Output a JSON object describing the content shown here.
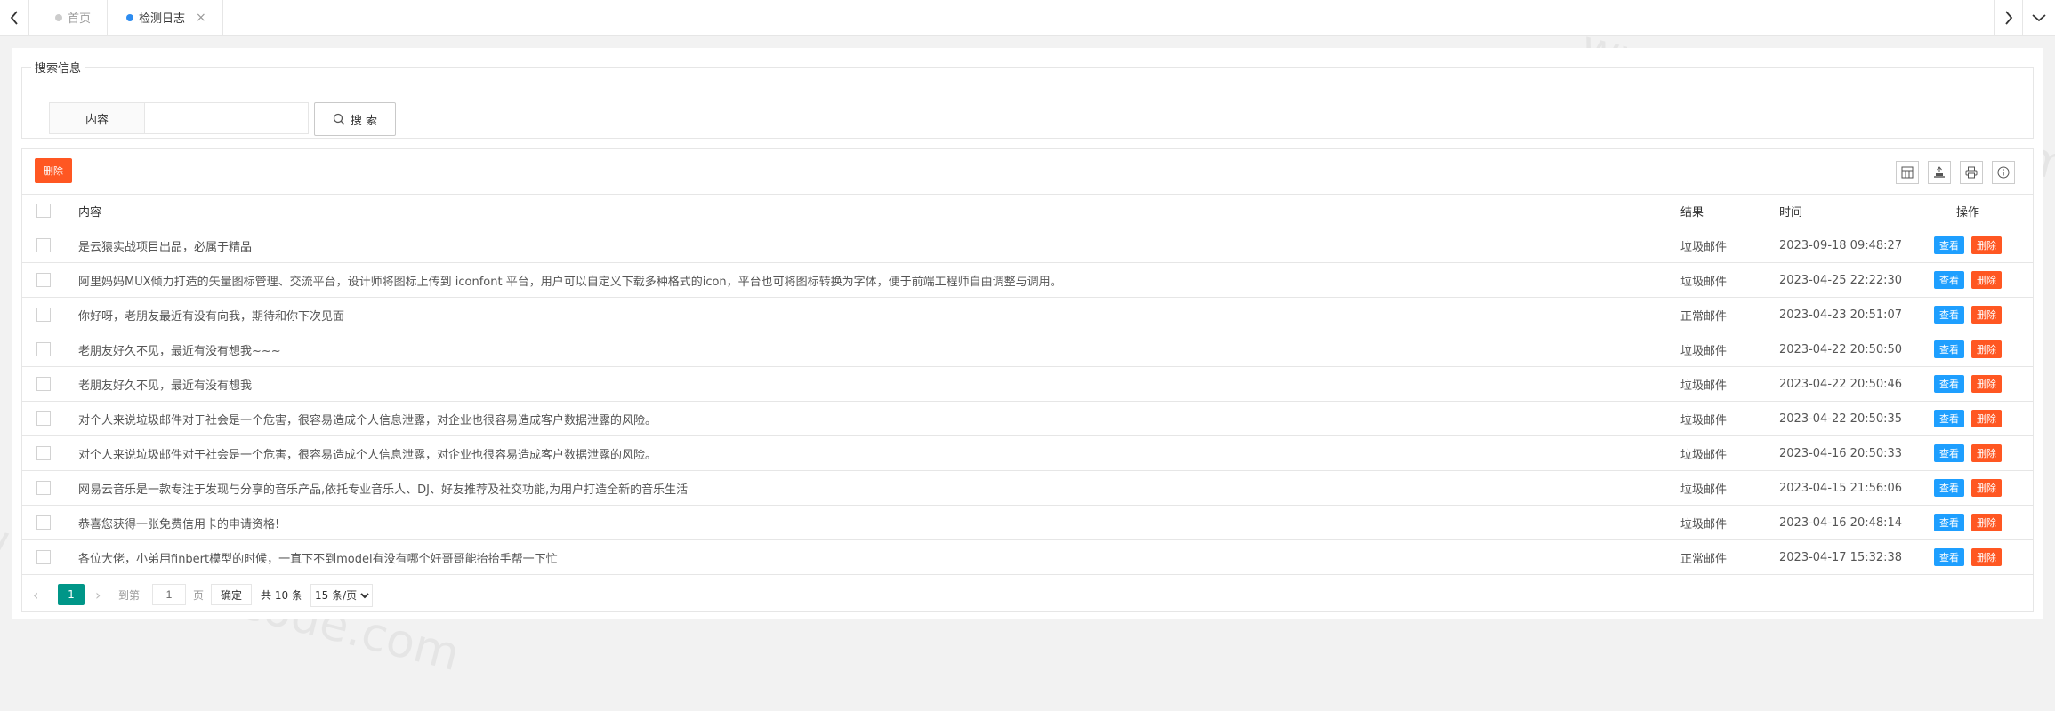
{
  "tabs": [
    {
      "label": "首页",
      "active": false
    },
    {
      "label": "检测日志",
      "active": true,
      "closable": true
    }
  ],
  "search": {
    "legend": "搜索信息",
    "label": "内容",
    "value": "",
    "button_label": "搜 索"
  },
  "toolbar": {
    "delete_label": "删除",
    "icons": [
      "columns-filter-icon",
      "export-icon",
      "print-icon",
      "info-icon"
    ]
  },
  "table": {
    "headers": {
      "content": "内容",
      "result": "结果",
      "time": "时间",
      "ops": "操作"
    },
    "view_label": "查看",
    "delete_label": "删除",
    "rows": [
      {
        "content": "是云猿实战项目出品，必属于精品",
        "result": "垃圾邮件",
        "time": "2023-09-18 09:48:27"
      },
      {
        "content": "阿里妈妈MUX倾力打造的矢量图标管理、交流平台，设计师将图标上传到 iconfont 平台，用户可以自定义下载多种格式的icon，平台也可将图标转换为字体，便于前端工程师自由调整与调用。",
        "result": "垃圾邮件",
        "time": "2023-04-25 22:22:30"
      },
      {
        "content": "你好呀，老朋友最近有没有向我，期待和你下次见面",
        "result": "正常邮件",
        "time": "2023-04-23 20:51:07"
      },
      {
        "content": "老朋友好久不见，最近有没有想我~~~",
        "result": "垃圾邮件",
        "time": "2023-04-22 20:50:50"
      },
      {
        "content": "老朋友好久不见，最近有没有想我",
        "result": "垃圾邮件",
        "time": "2023-04-22 20:50:46"
      },
      {
        "content": "对个人来说垃圾邮件对于社会是一个危害，很容易造成个人信息泄露，对企业也很容易造成客户数据泄露的风险。",
        "result": "垃圾邮件",
        "time": "2023-04-22 20:50:35"
      },
      {
        "content": "对个人来说垃圾邮件对于社会是一个危害，很容易造成个人信息泄露，对企业也很容易造成客户数据泄露的风险。",
        "result": "垃圾邮件",
        "time": "2023-04-16 20:50:33"
      },
      {
        "content": "网易云音乐是一款专注于发现与分享的音乐产品,依托专业音乐人、DJ、好友推荐及社交功能,为用户打造全新的音乐生活",
        "result": "垃圾邮件",
        "time": "2023-04-15 21:56:06"
      },
      {
        "content": "恭喜您获得一张免费信用卡的申请资格!",
        "result": "垃圾邮件",
        "time": "2023-04-16 20:48:14"
      },
      {
        "content": "各位大佬，小弟用finbert模型的时候，一直下不到model有没有哪个好哥哥能抬抬手帮一下忙",
        "result": "正常邮件",
        "time": "2023-04-17 15:32:38"
      }
    ]
  },
  "pager": {
    "current": "1",
    "goto_label": "到第",
    "page_input": "1",
    "page_unit": "页",
    "ok_label": "确定",
    "total": "共 10 条",
    "page_size": "15 条/页"
  },
  "watermark": "www.shiyuncode.com",
  "colors": {
    "danger": "#ff5722",
    "primary": "#1e9fff",
    "pager_active": "#009688"
  }
}
